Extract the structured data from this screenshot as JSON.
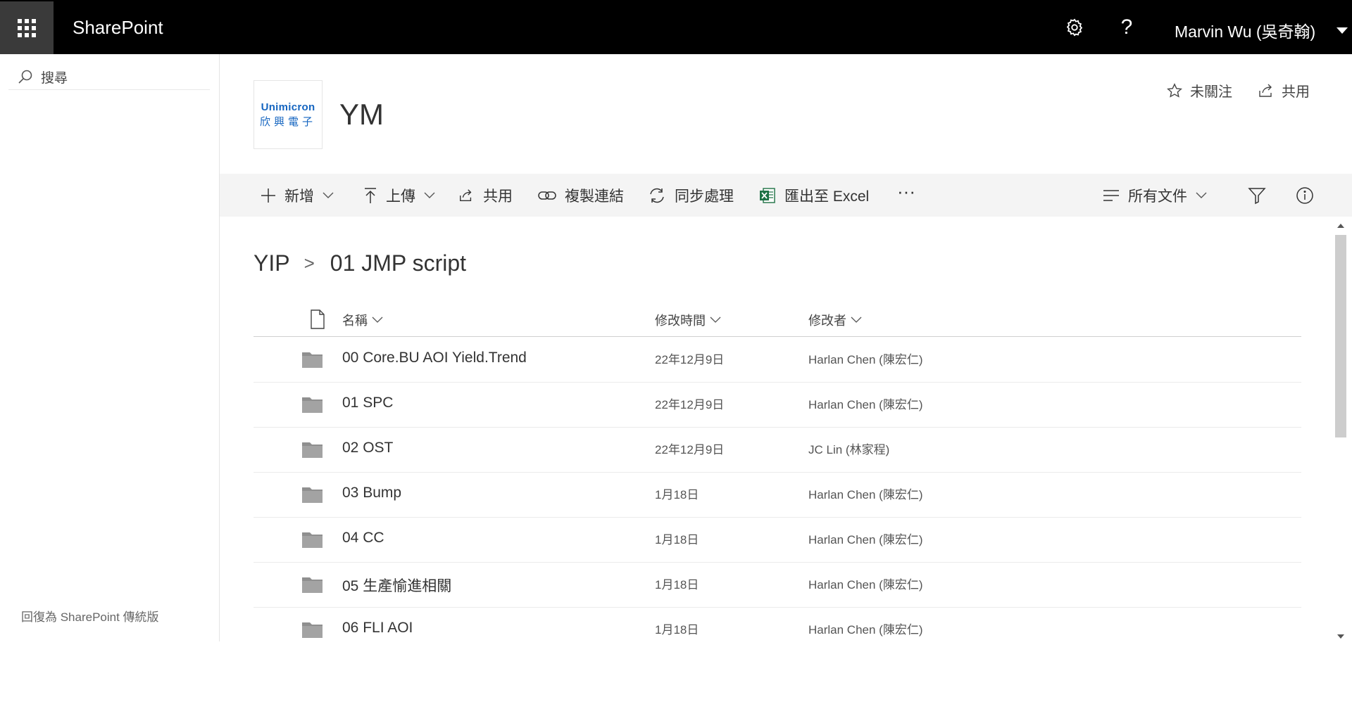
{
  "suite_bar": {
    "app_name": "SharePoint",
    "user_name": "Marvin Wu (吳奇翰)",
    "help_glyph": "?",
    "icons": [
      "waffle-icon",
      "gear-icon",
      "help-icon",
      "caret-down-icon"
    ]
  },
  "left_nav": {
    "search_placeholder": "搜尋",
    "classic_link": "回復為 SharePoint 傳統版"
  },
  "site_header": {
    "logo_line1": "Unimicron",
    "logo_line2": "欣興電子",
    "title": "YM",
    "follow_label": "未關注",
    "share_label": "共用"
  },
  "command_bar": {
    "new_label": "新增",
    "upload_label": "上傳",
    "share_label": "共用",
    "copy_link_label": "複製連結",
    "sync_label": "同步處理",
    "export_label": "匯出至 Excel",
    "more_label": "···",
    "view_label": "所有文件"
  },
  "breadcrumb": {
    "root": "YIP",
    "separator": ">",
    "current": "01 JMP script"
  },
  "list": {
    "columns": {
      "name": "名稱",
      "modified": "修改時間",
      "modified_by": "修改者"
    },
    "rows": [
      {
        "name": "00 Core.BU AOI Yield.Trend",
        "modified": "22年12月9日",
        "modified_by": "Harlan Chen (陳宏仁)"
      },
      {
        "name": "01 SPC",
        "modified": "22年12月9日",
        "modified_by": "Harlan Chen (陳宏仁)"
      },
      {
        "name": "02 OST",
        "modified": "22年12月9日",
        "modified_by": "JC Lin (林家程)"
      },
      {
        "name": "03 Bump",
        "modified": "1月18日",
        "modified_by": "Harlan Chen (陳宏仁)"
      },
      {
        "name": "04 CC",
        "modified": "1月18日",
        "modified_by": "Harlan Chen (陳宏仁)"
      },
      {
        "name": "05 生產愉進相關",
        "modified": "1月18日",
        "modified_by": "Harlan Chen (陳宏仁)"
      },
      {
        "name": "06 FLI AOI",
        "modified": "1月18日",
        "modified_by": "Harlan Chen (陳宏仁)"
      }
    ]
  },
  "colors": {
    "suite_bar_bg": "#000000",
    "waffle_bg": "#3a3a3a",
    "command_bar_bg": "#f4f4f4",
    "logo_blue": "#1565c0",
    "excel_green": "#1e7145",
    "folder_gray": "#8f8f8f"
  }
}
